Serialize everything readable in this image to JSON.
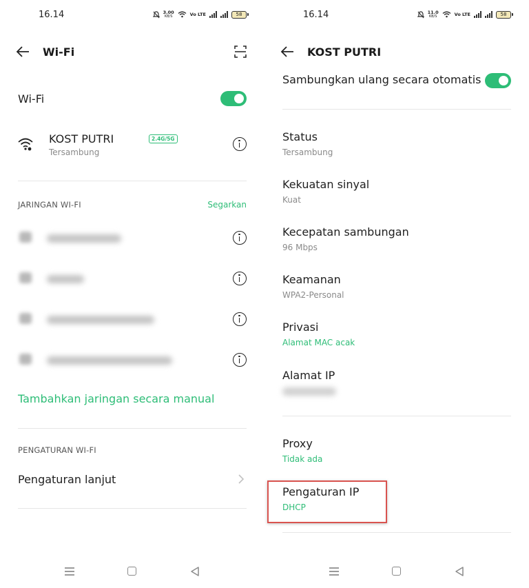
{
  "status_bar_left": {
    "time": "16.14",
    "speed": "3.00",
    "speed_unit": "KB/S",
    "lte": "Vo LTE",
    "battery": "58"
  },
  "status_bar_right": {
    "time": "16.14",
    "speed": "11.0",
    "speed_unit": "KB/S",
    "lte": "Vo LTE",
    "battery": "58"
  },
  "left_screen": {
    "header_title": "Wi-Fi",
    "wifi_label": "Wi-Fi",
    "wifi_enabled": true,
    "connected_network": {
      "name": "KOST PUTRI",
      "band": "2.4G/5G",
      "status": "Tersambung"
    },
    "networks_section_title": "JARINGAN WI-FI",
    "refresh_label": "Segarkan",
    "add_network_label": "Tambahkan jaringan secara manual",
    "settings_section_title": "PENGATURAN WI-FI",
    "advanced_settings_label": "Pengaturan lanjut"
  },
  "right_screen": {
    "header_title": "KOST PUTRI",
    "auto_reconnect_label": "Sambungkan ulang secara otomatis",
    "auto_reconnect_enabled": true,
    "details": [
      {
        "title": "Status",
        "value": "Tersambung"
      },
      {
        "title": "Kekuatan sinyal",
        "value": "Kuat"
      },
      {
        "title": "Kecepatan sambungan",
        "value": "96 Mbps"
      },
      {
        "title": "Keamanan",
        "value": "WPA2-Personal"
      },
      {
        "title": "Privasi",
        "value": "Alamat MAC acak"
      },
      {
        "title": "Alamat IP"
      }
    ],
    "proxy": {
      "title": "Proxy",
      "value": "Tidak ada"
    },
    "ip_settings": {
      "title": "Pengaturan IP",
      "value": "DHCP"
    }
  },
  "colors": {
    "accent": "#2ebd77",
    "highlight": "#d9534f"
  },
  "icons": [
    "back-arrow-icon",
    "scan-icon",
    "wifi-icon",
    "info-icon",
    "chevron-right-icon",
    "menu-icon",
    "home-icon",
    "back-triangle-icon"
  ]
}
